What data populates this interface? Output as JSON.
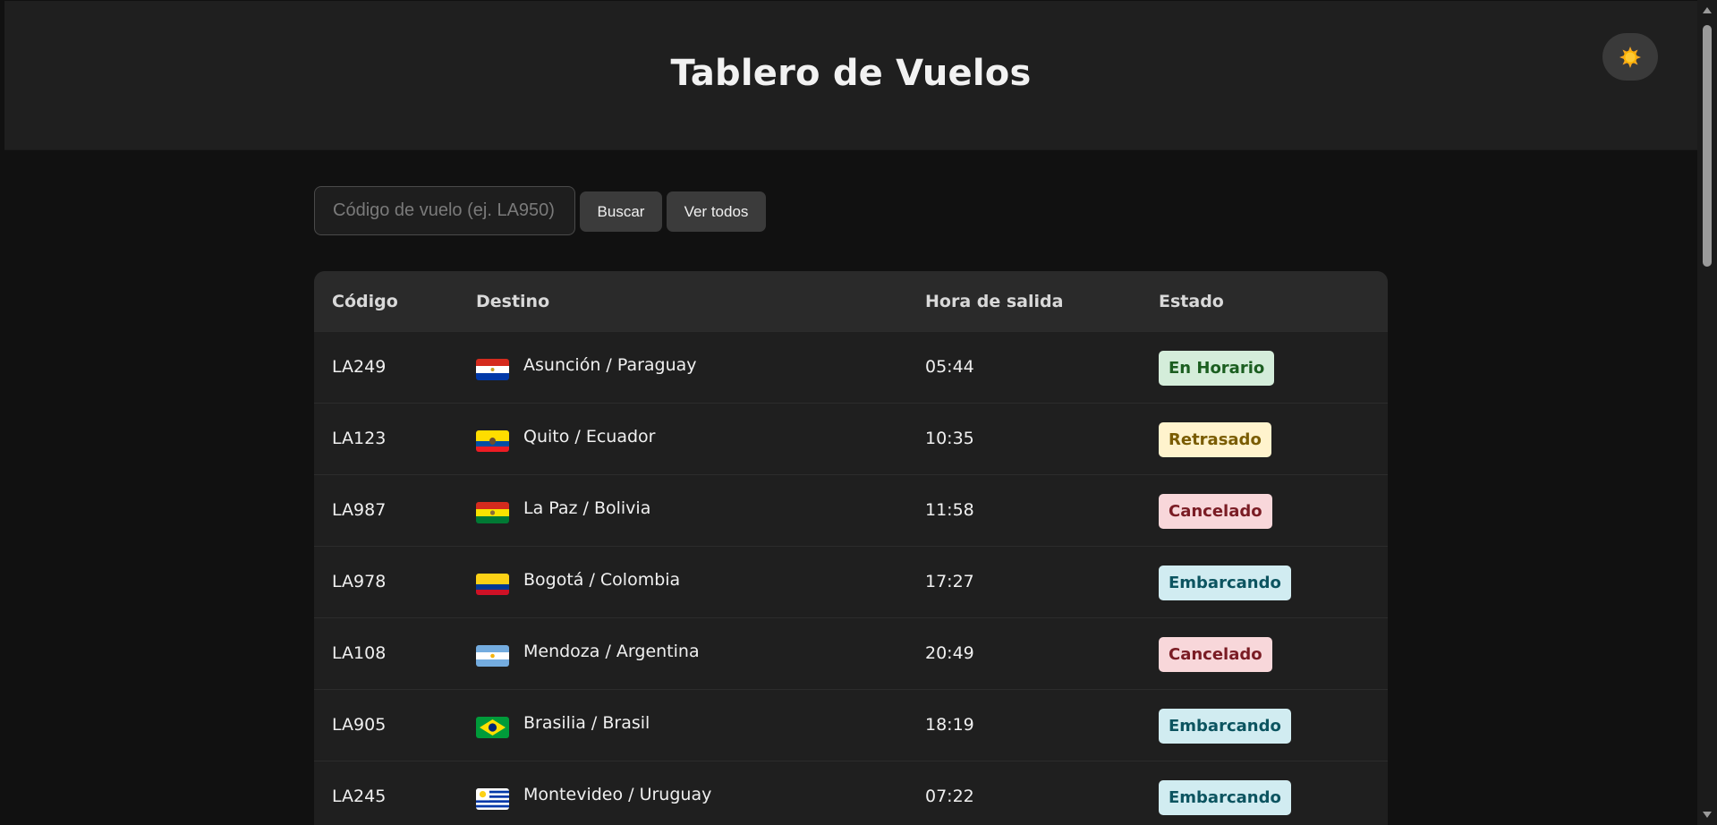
{
  "header": {
    "title": "Tablero de Vuelos",
    "theme_toggle_icon": "sun-icon"
  },
  "search": {
    "placeholder": "Código de vuelo (ej. LA950)",
    "value": "",
    "search_label": "Buscar",
    "all_label": "Ver todos"
  },
  "table": {
    "headers": {
      "code": "Código",
      "destination": "Destino",
      "departure": "Hora de salida",
      "status": "Estado"
    },
    "rows": [
      {
        "code": "LA249",
        "flag": "paraguay-flag-icon",
        "destination": "Asunción / Paraguay",
        "time": "05:44",
        "status": "En Horario",
        "status_kind": "on-time"
      },
      {
        "code": "LA123",
        "flag": "ecuador-flag-icon",
        "destination": "Quito / Ecuador",
        "time": "10:35",
        "status": "Retrasado",
        "status_kind": "delayed"
      },
      {
        "code": "LA987",
        "flag": "bolivia-flag-icon",
        "destination": "La Paz / Bolivia",
        "time": "11:58",
        "status": "Cancelado",
        "status_kind": "cancelled"
      },
      {
        "code": "LA978",
        "flag": "colombia-flag-icon",
        "destination": "Bogotá / Colombia",
        "time": "17:27",
        "status": "Embarcando",
        "status_kind": "boarding"
      },
      {
        "code": "LA108",
        "flag": "argentina-flag-icon",
        "destination": "Mendoza / Argentina",
        "time": "20:49",
        "status": "Cancelado",
        "status_kind": "cancelled"
      },
      {
        "code": "LA905",
        "flag": "brasil-flag-icon",
        "destination": "Brasilia / Brasil",
        "time": "18:19",
        "status": "Embarcando",
        "status_kind": "boarding"
      },
      {
        "code": "LA245",
        "flag": "uruguay-flag-icon",
        "destination": "Montevideo / Uruguay",
        "time": "07:22",
        "status": "Embarcando",
        "status_kind": "boarding"
      }
    ]
  },
  "colors": {
    "background": "#111111",
    "header_bg": "#1f1f1f",
    "on_time_bg": "#d4edda",
    "on_time_fg": "#1b5e20",
    "delayed_bg": "#fff3cd",
    "delayed_fg": "#7a5c00",
    "cancelled_bg": "#f8d7da",
    "cancelled_fg": "#7a1c24",
    "boarding_bg": "#d1ecf1",
    "boarding_fg": "#0c5460"
  }
}
